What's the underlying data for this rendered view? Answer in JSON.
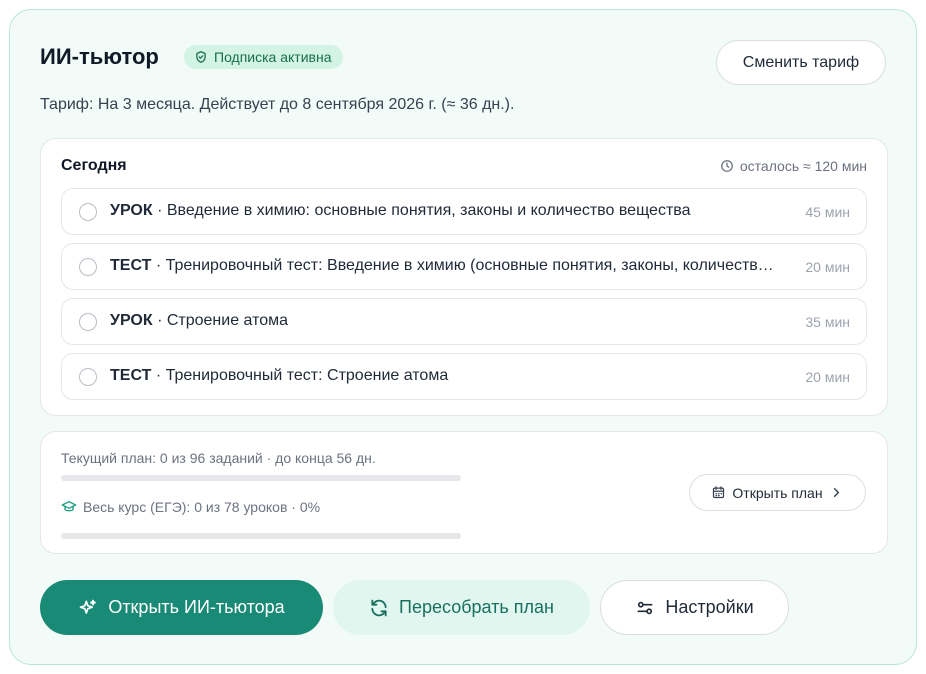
{
  "header": {
    "title": "ИИ-тьютор",
    "badge": "Подписка активна",
    "change_tariff": "Сменить тариф",
    "plan_info": "Тариф: На 3 месяца. Действует до 8 сентября 2026 г. (≈ 36 дн.)."
  },
  "today": {
    "title": "Сегодня",
    "remaining": "осталось ≈ 120 мин",
    "tasks": [
      {
        "type": "УРОК",
        "text": " · Введение в химию: основные понятия, законы и количество вещества",
        "duration": "45 мин",
        "done": false
      },
      {
        "type": "ТЕСТ",
        "text": " · Тренировочный тест: Введение в химию (основные понятия, законы, количество вещества)",
        "duration": "20 мин",
        "done": false
      },
      {
        "type": "УРОК",
        "text": " · Строение атома",
        "duration": "35 мин",
        "done": false
      },
      {
        "type": "ТЕСТ",
        "text": " · Тренировочный тест: Строение атома",
        "duration": "20 мин",
        "done": false
      }
    ]
  },
  "progress": {
    "current_plan": "Текущий план: 0 из 96 заданий · до конца 56 дн.",
    "current_plan_fraction": 0,
    "course": "Весь курс (ЕГЭ): 0 из 78 уроков · 0%",
    "course_fraction": 0,
    "open_plan": "Открыть план"
  },
  "actions": {
    "open_tutor": "Открыть ИИ-тьютора",
    "rebuild": "Пересобрать план",
    "settings": "Настройки"
  },
  "colors": {
    "accent": "#198a76",
    "badge_bg": "#d3f3e5",
    "card_bg": "#f3fbf8",
    "card_border": "#b9e8d6"
  },
  "icons": {
    "badge": "shield-check-icon",
    "remaining": "clock-icon",
    "course": "graduation-cap-icon",
    "open_plan": "calendar-icon",
    "open_plan_arrow": "chevron-right-icon",
    "open_tutor": "sparkles-icon",
    "rebuild": "refresh-icon",
    "settings": "sliders-icon"
  }
}
